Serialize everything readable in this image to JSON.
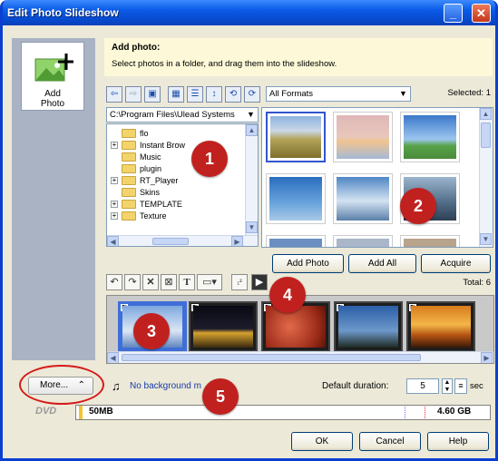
{
  "window": {
    "title": "Edit Photo Slideshow"
  },
  "left": {
    "add_photo_label_1": "Add",
    "add_photo_label_2": "Photo"
  },
  "instructions": {
    "heading": "Add photo:",
    "detail": "Select photos in a folder, and drag them into the slideshow."
  },
  "browser": {
    "path": "C:\\Program Files\\Ulead Systems",
    "format": "All Formats",
    "selected": "Selected: 1",
    "folders": [
      "flo",
      "Instant Brow",
      "Music",
      "plugin",
      "RT_Player",
      "Skins",
      "TEMPLATE",
      "Texture"
    ],
    "add_photo_button": "Add Photo",
    "add_all_button": "Add All",
    "acquire_button": "Acquire"
  },
  "slideshow": {
    "total": "Total: 6",
    "music": "No background m",
    "default_duration_label": "Default duration:",
    "default_duration_value": "5",
    "sec": "sec"
  },
  "more": {
    "label": "More..."
  },
  "dvd": {
    "label": "DVD",
    "used": "50MB",
    "capacity": "4.60 GB"
  },
  "buttons": {
    "ok": "OK",
    "cancel": "Cancel",
    "help": "Help"
  },
  "callouts": [
    "1",
    "2",
    "3",
    "4",
    "5"
  ],
  "colors": {
    "callout": "#c0211f",
    "title_bar": "#0a5ae6",
    "instructions_bg": "#fdf8d7"
  }
}
